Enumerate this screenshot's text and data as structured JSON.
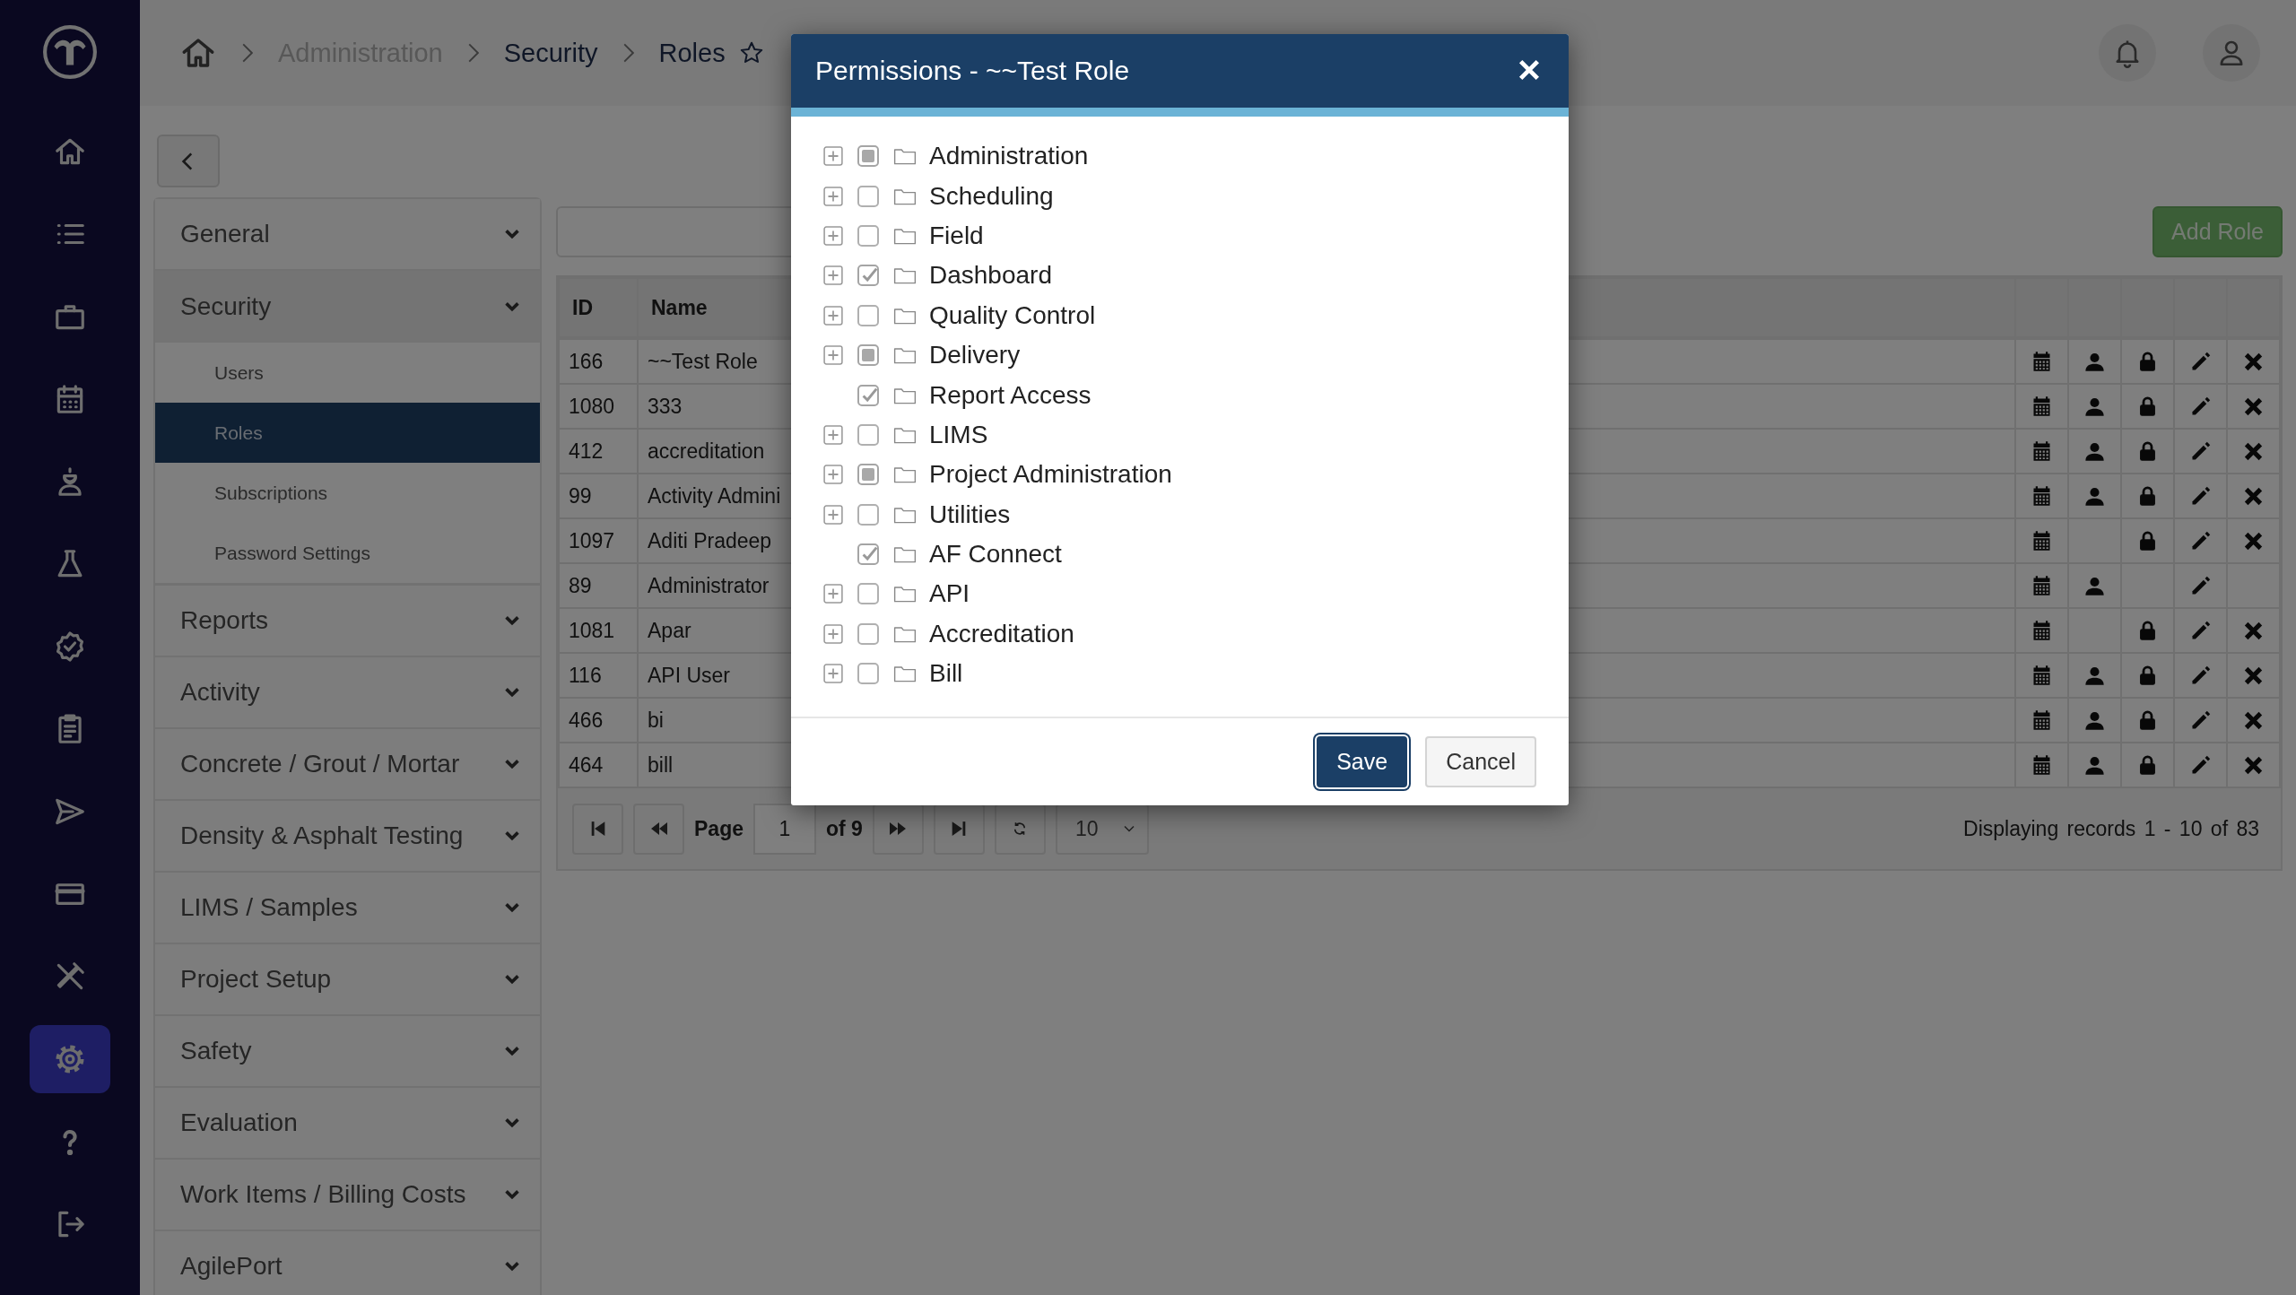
{
  "nav_items": [
    {
      "kind": "home",
      "selected": false
    },
    {
      "kind": "list",
      "selected": false
    },
    {
      "kind": "briefcase",
      "selected": false
    },
    {
      "kind": "calendar",
      "selected": false
    },
    {
      "kind": "worker",
      "selected": false
    },
    {
      "kind": "flask",
      "selected": false
    },
    {
      "kind": "badge",
      "selected": false
    },
    {
      "kind": "clipboard",
      "selected": false
    },
    {
      "kind": "send",
      "selected": false
    },
    {
      "kind": "card",
      "selected": false
    },
    {
      "kind": "tools",
      "selected": false
    },
    {
      "kind": "settings",
      "selected": true
    },
    {
      "kind": "help",
      "selected": false
    },
    {
      "kind": "logout",
      "selected": false
    }
  ],
  "breadcrumb": [
    {
      "label": "Administration",
      "disabled": true
    },
    {
      "label": "Security",
      "disabled": false
    },
    {
      "label": "Roles",
      "disabled": false
    }
  ],
  "favorite": false,
  "sidebar": [
    {
      "label": "General",
      "expanded": false
    },
    {
      "label": "Security",
      "expanded": true,
      "children": [
        {
          "label": "Users",
          "selected": false
        },
        {
          "label": "Roles",
          "selected": true
        },
        {
          "label": "Subscriptions",
          "selected": false
        },
        {
          "label": "Password Settings",
          "selected": false
        }
      ]
    },
    {
      "label": "Reports",
      "expanded": false
    },
    {
      "label": "Activity",
      "expanded": false
    },
    {
      "label": "Concrete / Grout / Mortar",
      "expanded": false
    },
    {
      "label": "Density & Asphalt Testing",
      "expanded": false
    },
    {
      "label": "LIMS / Samples",
      "expanded": false
    },
    {
      "label": "Project Setup",
      "expanded": false
    },
    {
      "label": "Safety",
      "expanded": false
    },
    {
      "label": "Evaluation",
      "expanded": false
    },
    {
      "label": "Work Items / Billing Costs",
      "expanded": false
    },
    {
      "label": "AgilePort",
      "expanded": false
    }
  ],
  "add_button": "Add Role",
  "table": {
    "columns": [
      "ID",
      "Name"
    ],
    "rows": [
      {
        "id": "166",
        "name": "~~Test Role",
        "schedule": true,
        "users": true,
        "permissions": true,
        "edit": true,
        "delete": true
      },
      {
        "id": "1080",
        "name": "333",
        "schedule": true,
        "users": true,
        "permissions": true,
        "edit": true,
        "delete": true
      },
      {
        "id": "412",
        "name": "accreditation",
        "schedule": true,
        "users": true,
        "permissions": true,
        "edit": true,
        "delete": true
      },
      {
        "id": "99",
        "name": "Activity Admini",
        "schedule": true,
        "users": true,
        "permissions": true,
        "edit": true,
        "delete": true
      },
      {
        "id": "1097",
        "name": "Aditi Pradeep",
        "schedule": true,
        "users": false,
        "permissions": true,
        "edit": true,
        "delete": true
      },
      {
        "id": "89",
        "name": "Administrator",
        "schedule": true,
        "users": true,
        "permissions": false,
        "edit": true,
        "delete": false
      },
      {
        "id": "1081",
        "name": "Apar",
        "schedule": true,
        "users": false,
        "permissions": true,
        "edit": true,
        "delete": true
      },
      {
        "id": "116",
        "name": "API User",
        "schedule": true,
        "users": true,
        "permissions": true,
        "edit": true,
        "delete": true
      },
      {
        "id": "466",
        "name": "bi",
        "schedule": true,
        "users": true,
        "permissions": true,
        "edit": true,
        "delete": true
      },
      {
        "id": "464",
        "name": "bill",
        "schedule": true,
        "users": true,
        "permissions": true,
        "edit": true,
        "delete": true
      }
    ]
  },
  "pager": {
    "page_label": "Page",
    "page": "1",
    "of": "of 9",
    "page_size": "10",
    "summary": "Displaying records 1 - 10 of 83"
  },
  "modal": {
    "title": "Permissions - ~~Test Role",
    "tree": [
      {
        "label": "Administration",
        "expandable": true,
        "expanded": false,
        "checked": false,
        "indeterminate": true
      },
      {
        "label": "Scheduling",
        "expandable": true,
        "expanded": false,
        "checked": false,
        "indeterminate": false
      },
      {
        "label": "Field",
        "expandable": true,
        "expanded": false,
        "checked": false,
        "indeterminate": false
      },
      {
        "label": "Dashboard",
        "expandable": true,
        "expanded": false,
        "checked": true,
        "indeterminate": false
      },
      {
        "label": "Quality Control",
        "expandable": true,
        "expanded": false,
        "checked": false,
        "indeterminate": false
      },
      {
        "label": "Delivery",
        "expandable": true,
        "expanded": false,
        "checked": false,
        "indeterminate": true
      },
      {
        "label": "Report Access",
        "expandable": false,
        "checked": true,
        "indeterminate": false
      },
      {
        "label": "LIMS",
        "expandable": true,
        "expanded": false,
        "checked": false,
        "indeterminate": false
      },
      {
        "label": "Project Administration",
        "expandable": true,
        "expanded": false,
        "checked": false,
        "indeterminate": true
      },
      {
        "label": "Utilities",
        "expandable": true,
        "expanded": false,
        "checked": false,
        "indeterminate": false
      },
      {
        "label": "AF Connect",
        "expandable": false,
        "checked": true,
        "indeterminate": false
      },
      {
        "label": "API",
        "expandable": true,
        "expanded": false,
        "checked": false,
        "indeterminate": false
      },
      {
        "label": "Accreditation",
        "expandable": true,
        "expanded": false,
        "checked": false,
        "indeterminate": false
      },
      {
        "label": "Bill",
        "expandable": true,
        "expanded": false,
        "checked": false,
        "indeterminate": false
      }
    ],
    "buttons": [
      {
        "label": "Save",
        "primary": true
      },
      {
        "label": "Cancel",
        "primary": false
      }
    ]
  }
}
